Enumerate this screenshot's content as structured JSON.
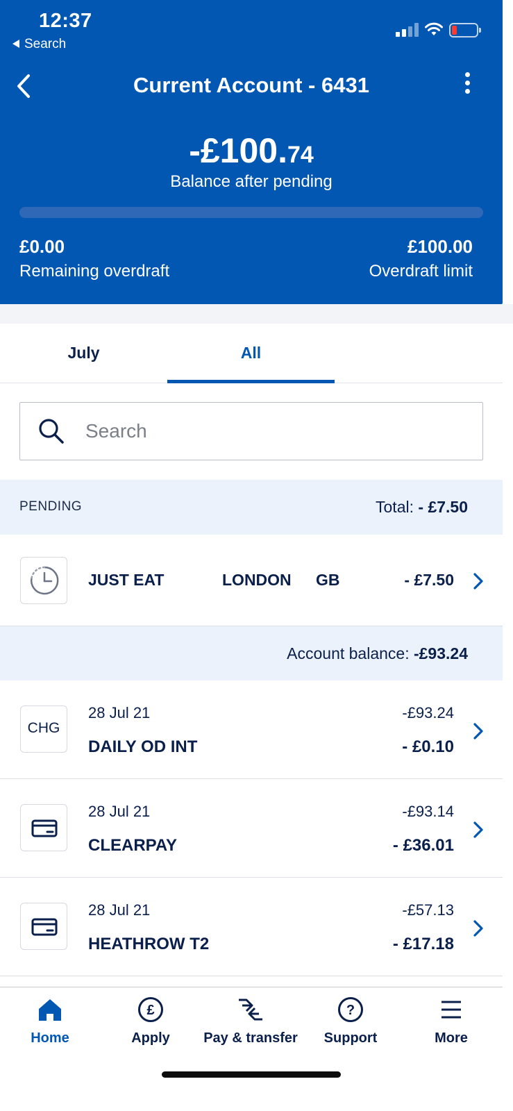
{
  "status_bar": {
    "time": "12:37",
    "back_label": "Search"
  },
  "header": {
    "title": "Current Account - 6431",
    "balance_main": "-£100.",
    "balance_pence": "74",
    "balance_label": "Balance after pending",
    "overdraft_used_fraction": 1.0,
    "remaining_overdraft": "£0.00",
    "remaining_overdraft_label": "Remaining overdraft",
    "overdraft_limit": "£100.00",
    "overdraft_limit_label": "Overdraft limit"
  },
  "tabs": [
    {
      "label": "July",
      "active": false
    },
    {
      "label": "All",
      "active": true
    }
  ],
  "search": {
    "placeholder": "Search"
  },
  "pending": {
    "label": "PENDING",
    "total_prefix": "Total: ",
    "total_value": "- £7.50",
    "item": {
      "merchant": "JUST EAT",
      "city": "LONDON",
      "country": "GB",
      "amount": "- £7.50",
      "icon": "clock-icon"
    }
  },
  "account_balance": {
    "prefix": "Account balance: ",
    "value": "-£93.24"
  },
  "transactions": [
    {
      "date": "28 Jul 21",
      "name": "DAILY OD INT",
      "balance": "-£93.24",
      "amount": "- £0.10",
      "icon_text": "CHG"
    },
    {
      "date": "28 Jul 21",
      "name": "CLEARPAY",
      "balance": "-£93.14",
      "amount": "- £36.01",
      "icon": "card-icon"
    },
    {
      "date": "28 Jul 21",
      "name": "HEATHROW T2",
      "balance": "-£57.13",
      "amount": "- £17.18",
      "icon": "card-icon"
    }
  ],
  "nav": [
    {
      "label": "Home",
      "icon": "home-icon",
      "active": true
    },
    {
      "label": "Apply",
      "icon": "pound-icon",
      "active": false
    },
    {
      "label": "Pay & transfer",
      "icon": "transfer-icon",
      "active": false
    },
    {
      "label": "Support",
      "icon": "help-icon",
      "active": false
    },
    {
      "label": "More",
      "icon": "menu-icon",
      "active": false
    }
  ],
  "colors": {
    "brand_blue": "#0257b3",
    "navy_text": "#0b1f4b",
    "band_bg": "#ebf2fb"
  }
}
